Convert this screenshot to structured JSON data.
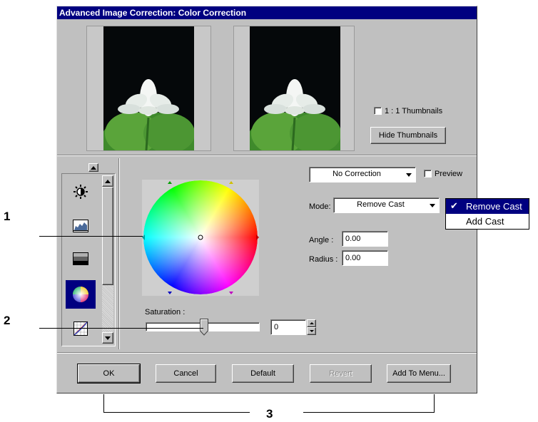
{
  "dialog": {
    "title": "Advanced Image Correction: Color Correction"
  },
  "thumbnails": {
    "before_image": "lotus-flower-photo",
    "after_image": "lotus-flower-photo",
    "one_to_one_label": "1 : 1 Thumbnails",
    "one_to_one_checked": false,
    "hide_button_label": "Hide Thumbnails"
  },
  "tool_list": {
    "items": [
      {
        "icon": "brightness-icon"
      },
      {
        "icon": "levels-icon"
      },
      {
        "icon": "contrast-icon"
      },
      {
        "icon": "color-wheel-icon",
        "selected": true
      },
      {
        "icon": "curves-icon"
      }
    ]
  },
  "correction": {
    "preset_value": "No Correction",
    "preview_label": "Preview",
    "preview_checked": false,
    "mode_label": "Mode:",
    "mode_value": "Remove Cast",
    "mode_options": [
      "Remove Cast",
      "Add Cast"
    ],
    "mode_selected_index": 0,
    "angle_label": "Angle :",
    "angle_value": "0.00",
    "radius_label": "Radius :",
    "radius_value": "0.00",
    "saturation_label": "Saturation :",
    "saturation_value": "0"
  },
  "buttons": {
    "ok": "OK",
    "cancel": "Cancel",
    "default": "Default",
    "revert": "Revert",
    "add_to_menu": "Add To Menu..."
  },
  "callouts": {
    "one": "1",
    "two": "2",
    "three": "3"
  },
  "colors": {
    "title_bar": "#000080",
    "dialog_face": "#c0c0c0",
    "selection": "#000080"
  }
}
